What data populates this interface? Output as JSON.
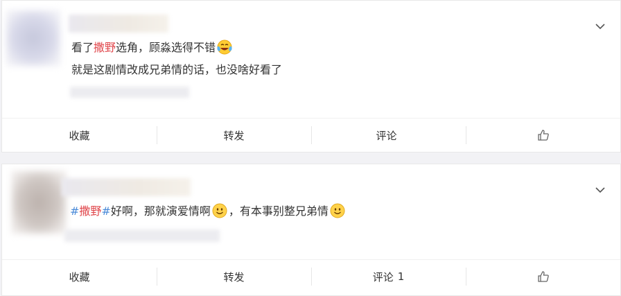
{
  "comments": [
    {
      "lines": [
        {
          "pre": "看了",
          "keyword": "撒野",
          "post": "选角，顾淼选得不错",
          "emoji": "tear-laugh-emoji"
        },
        {
          "text": "就是这剧情改成兄弟情的话，也没啥好看了"
        }
      ],
      "actions": {
        "collect": "收藏",
        "repost": "转发",
        "comment": "评论",
        "comment_count": ""
      }
    },
    {
      "line": {
        "hash_open": "#",
        "keyword": "撒野",
        "hash_close": "#",
        "part1": "好啊，那就演爱情啊",
        "part2": "，有本事别整兄弟情"
      },
      "actions": {
        "collect": "收藏",
        "repost": "转发",
        "comment": "评论",
        "comment_count": "1"
      }
    }
  ],
  "icons": {
    "menu": "chevron-down-icon",
    "like": "thumbs-up-icon",
    "smile": "smile-emoji"
  },
  "colors": {
    "keyword": "#e0454a",
    "hashtag": "#4a8ad8",
    "text": "#333333"
  }
}
